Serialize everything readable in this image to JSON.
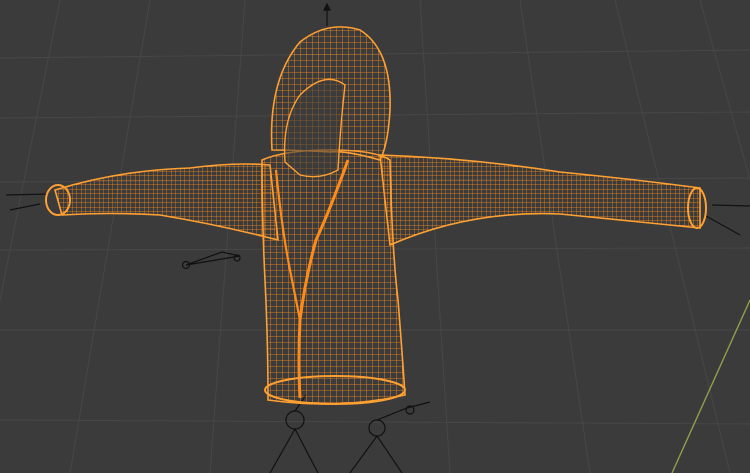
{
  "viewport": {
    "name": "3D Viewport",
    "shading_mode": "wireframe"
  },
  "scene": {
    "selected_object": "hoodie-mesh",
    "rig": "armature"
  },
  "colors": {
    "background": "#3b3b3b",
    "grid_line": "#4a4a4a",
    "grid_line_major": "#555555",
    "y_axis": "#8fa04a",
    "wire_selected": "#ff8c1a",
    "wire_fill": "rgba(255,140,26,0.18)",
    "wire_outline": "#ffa033",
    "bone": "#111111"
  },
  "icons": [
    "armature-bone-icon",
    "empty-target-icon"
  ]
}
